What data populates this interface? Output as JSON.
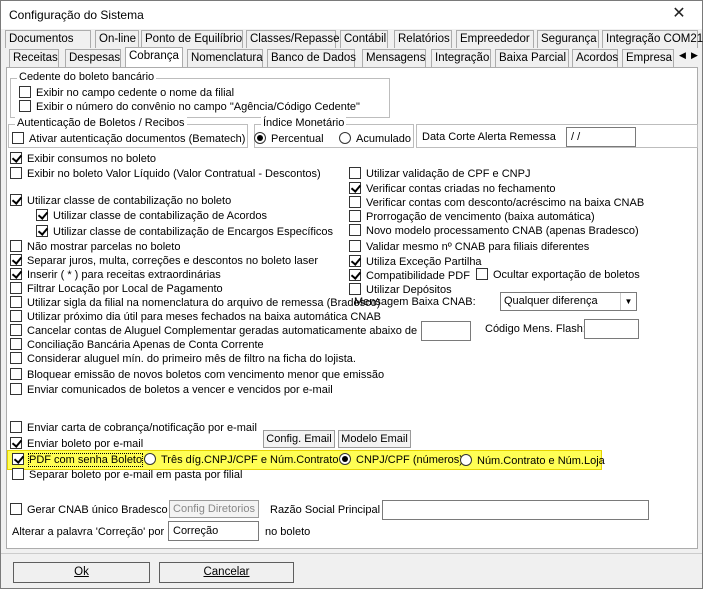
{
  "window": {
    "title": "Configuração do Sistema",
    "close_label": "✕"
  },
  "tabs_row1": [
    "Documentos",
    "On-line",
    "Ponto de Equilíbrio",
    "Classes/Repasse",
    "Contábil",
    "Relatórios",
    "Empreededor",
    "Segurança",
    "Integração COM21"
  ],
  "tabs_row2": [
    "Receitas",
    "Despesas",
    "Cobrança",
    "Nomenclatura",
    "Banco de Dados",
    "Mensagens",
    "Integração",
    "Baixa Parcial",
    "Acordos",
    "Empresa"
  ],
  "active_tab": "Cobrança",
  "cedente": {
    "legend": "Cedente do boleto bancário",
    "opt1": "Exibir no campo cedente o nome da filial",
    "opt2": "Exibir o número do convênio no campo \"Agência/Código Cedente\""
  },
  "autenticacao": {
    "legend": "Autenticação de Boletos / Recibos",
    "opt": "Ativar autenticação documentos (Bematech)"
  },
  "indice": {
    "legend": "Índice Monetário",
    "opt1": "Percentual",
    "opt2": "Acumulado"
  },
  "data_corte": {
    "label": "Data Corte Alerta Remessa",
    "value": " / /"
  },
  "left_options": [
    "Exibir consumos no boleto",
    "Exibir no boleto Valor Líquido (Valor Contratual - Descontos)",
    "Utilizar classe de contabilização no boleto",
    "Utilizar classe de contabilização de Acordos",
    "Utilizar classe de contabilização de Encargos Específicos",
    "Não mostrar parcelas no boleto",
    "Separar juros, multa, correções e descontos no boleto laser",
    "Inserir ( * ) para receitas extraordinárias",
    "Filtrar Locação por Local de Pagamento",
    "Utilizar sigla da filial na nomenclatura do arquivo de remessa (Bradesco)",
    "Utilizar próximo dia útil para meses fechados na baixa automática CNAB",
    "Cancelar contas de Aluguel Complementar geradas automaticamente abaixo de R$",
    "Conciliação Bancária Apenas de Conta Corrente",
    "Considerar aluguel mín. do primeiro mês de filtro na ficha do lojista.",
    "Bloquear emissão de novos boletos com vencimento menor que emissão",
    "Enviar comunicados de boletos a vencer e vencidos por e-mail"
  ],
  "right_options": [
    "Utilizar validação de CPF e CNPJ",
    "Verificar contas criadas no fechamento",
    "Verificar contas com desconto/acréscimo na baixa CNAB",
    "Prorrogação de vencimento (baixa automática)",
    "Novo modelo processamento CNAB (apenas Bradesco)",
    "Validar mesmo nº CNAB para filiais diferentes",
    "Utiliza Exceção Partilha",
    "Compatibilidade PDF",
    "Ocultar exportação de boletos",
    "Utilizar Depósitos"
  ],
  "mensagem_baixa": {
    "label": "Mensagem Baixa CNAB:",
    "value": "Qualquer diferença"
  },
  "codigo_mens": {
    "label": "Código Mens. Flash:"
  },
  "email": {
    "carta": "Enviar carta de cobrança/notificação por e-mail",
    "boleto": "Enviar boleto por e-mail",
    "config_btn": "Config. Email",
    "modelo_btn": "Modelo Email",
    "pdf_senha": "PDF com senha Boleto",
    "r1": "Três díg.CNPJ/CPF e Núm.Contrato",
    "r2": "CNPJ/CPF (números)",
    "r3": "Núm.Contrato e Núm.Loja",
    "separar": "Separar boleto por e-mail em pasta por filial"
  },
  "cnab": {
    "gerar": "Gerar CNAB único Bradesco",
    "config_btn": "Config Diretorios",
    "razao_label": "Razão Social Principal"
  },
  "correcao": {
    "label": "Alterar a palavra 'Correção' por",
    "value": "Correção",
    "suffix": "no boleto"
  },
  "buttons": {
    "ok": "Ok",
    "cancel": "Cancelar"
  },
  "colors": {
    "highlight": "#fffe55"
  }
}
